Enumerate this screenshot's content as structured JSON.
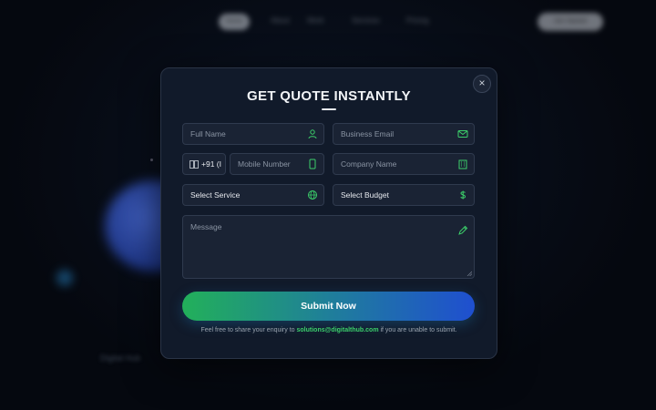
{
  "nav": {
    "items": [
      "Home",
      "About",
      "Work",
      "Services",
      "Pricing"
    ],
    "cta": "Get Started"
  },
  "background": {
    "footer_text": "Digital Hub"
  },
  "modal": {
    "title": "GET QUOTE INSTANTLY",
    "close_label": "×",
    "fields": {
      "full_name_placeholder": "Full Name",
      "business_email_placeholder": "Business Email",
      "country_code_value": "+91 (I",
      "mobile_placeholder": "Mobile Number",
      "company_placeholder": "Company Name",
      "service_value": "Select Service",
      "budget_value": "Select Budget",
      "message_placeholder": "Message"
    },
    "submit_label": "Submit Now",
    "footnote": {
      "prefix": "Feel free to share your enquiry to ",
      "email": "solutions@digitalthub.com",
      "suffix": " if you are unable to submit."
    }
  },
  "colors": {
    "accent_green": "#3ccf6a",
    "accent_blue": "#1f4fd0",
    "modal_bg": "#111a2a"
  },
  "icons": [
    "user-icon",
    "mail-icon",
    "flag-icon",
    "phone-icon",
    "building-icon",
    "globe-icon",
    "dollar-icon",
    "pen-icon",
    "close-icon"
  ]
}
